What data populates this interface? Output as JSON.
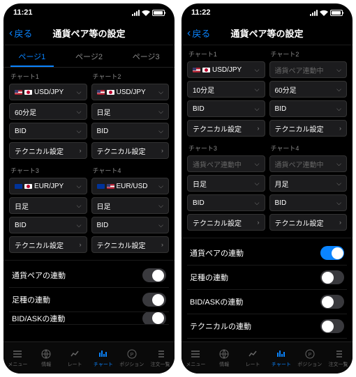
{
  "screens": [
    {
      "status": {
        "time": "11:21"
      },
      "nav": {
        "back": "戻る",
        "title": "通貨ペア等の設定"
      },
      "tabs": [
        "ページ1",
        "ページ2",
        "ページ3"
      ],
      "activeTab": 0,
      "charts": [
        {
          "label": "チャート1",
          "pair": "USD/JPY",
          "flags": [
            "us",
            "jp"
          ],
          "timeframe": "60分足",
          "bidask": "BID",
          "tech": "テクニカル設定",
          "linked": false
        },
        {
          "label": "チャート2",
          "pair": "USD/JPY",
          "flags": [
            "us",
            "jp"
          ],
          "timeframe": "日足",
          "bidask": "BID",
          "tech": "テクニカル設定",
          "linked": false
        },
        {
          "label": "チャート3",
          "pair": "EUR/JPY",
          "flags": [
            "eu",
            "jp"
          ],
          "timeframe": "日足",
          "bidask": "BID",
          "tech": "テクニカル設定",
          "linked": false
        },
        {
          "label": "チャート4",
          "pair": "EUR/USD",
          "flags": [
            "eu",
            "us"
          ],
          "timeframe": "日足",
          "bidask": "BID",
          "tech": "テクニカル設定",
          "linked": false
        }
      ],
      "toggles": [
        {
          "label": "通貨ペアの連動",
          "on": false
        },
        {
          "label": "足種の連動",
          "on": false
        },
        {
          "label": "BID/ASKの連動",
          "on": false
        }
      ],
      "tabbar": [
        "メニュー",
        "情報",
        "レート",
        "チャート",
        "ポジション",
        "注文一覧"
      ],
      "activeTabbar": 3
    },
    {
      "status": {
        "time": "11:22"
      },
      "nav": {
        "back": "戻る",
        "title": "通貨ペア等の設定"
      },
      "charts": [
        {
          "label": "チャート1",
          "pair": "USD/JPY",
          "flags": [
            "us",
            "jp"
          ],
          "timeframe": "10分足",
          "bidask": "BID",
          "tech": "テクニカル設定",
          "linked": false
        },
        {
          "label": "チャート2",
          "pair": "通貨ペア連動中",
          "flags": [],
          "timeframe": "60分足",
          "bidask": "BID",
          "tech": "テクニカル設定",
          "linked": true
        },
        {
          "label": "チャート3",
          "pair": "通貨ペア連動中",
          "flags": [],
          "timeframe": "日足",
          "bidask": "BID",
          "tech": "テクニカル設定",
          "linked": true
        },
        {
          "label": "チャート4",
          "pair": "通貨ペア連動中",
          "flags": [],
          "timeframe": "月足",
          "bidask": "BID",
          "tech": "テクニカル設定",
          "linked": true
        }
      ],
      "toggles": [
        {
          "label": "通貨ペアの連動",
          "on": true
        },
        {
          "label": "足種の連動",
          "on": false
        },
        {
          "label": "BID/ASKの連動",
          "on": false
        },
        {
          "label": "テクニカルの連動",
          "on": false
        }
      ],
      "tabbar": [
        "メニュー",
        "情報",
        "レート",
        "チャート",
        "ポジション",
        "注文一覧"
      ],
      "activeTabbar": 3
    }
  ]
}
